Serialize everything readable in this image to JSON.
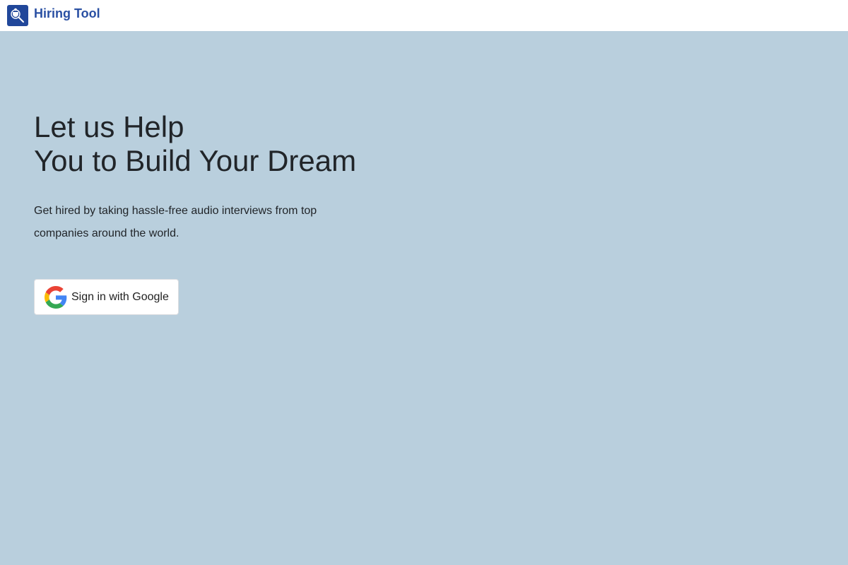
{
  "header": {
    "brand_name": "Hiring Tool",
    "logo_icon": "person-search-icon",
    "brand_color": "#2a50a3",
    "logo_bg": "#21479a"
  },
  "hero": {
    "title_line1": "Let us Help",
    "title_line2": "You to Build Your Dream",
    "description": "Get hired by taking hassle-free audio interviews from top companies around the world.",
    "background": "#b9cfdd"
  },
  "signin": {
    "label": "Sign in with Google",
    "icon": "google-icon"
  }
}
